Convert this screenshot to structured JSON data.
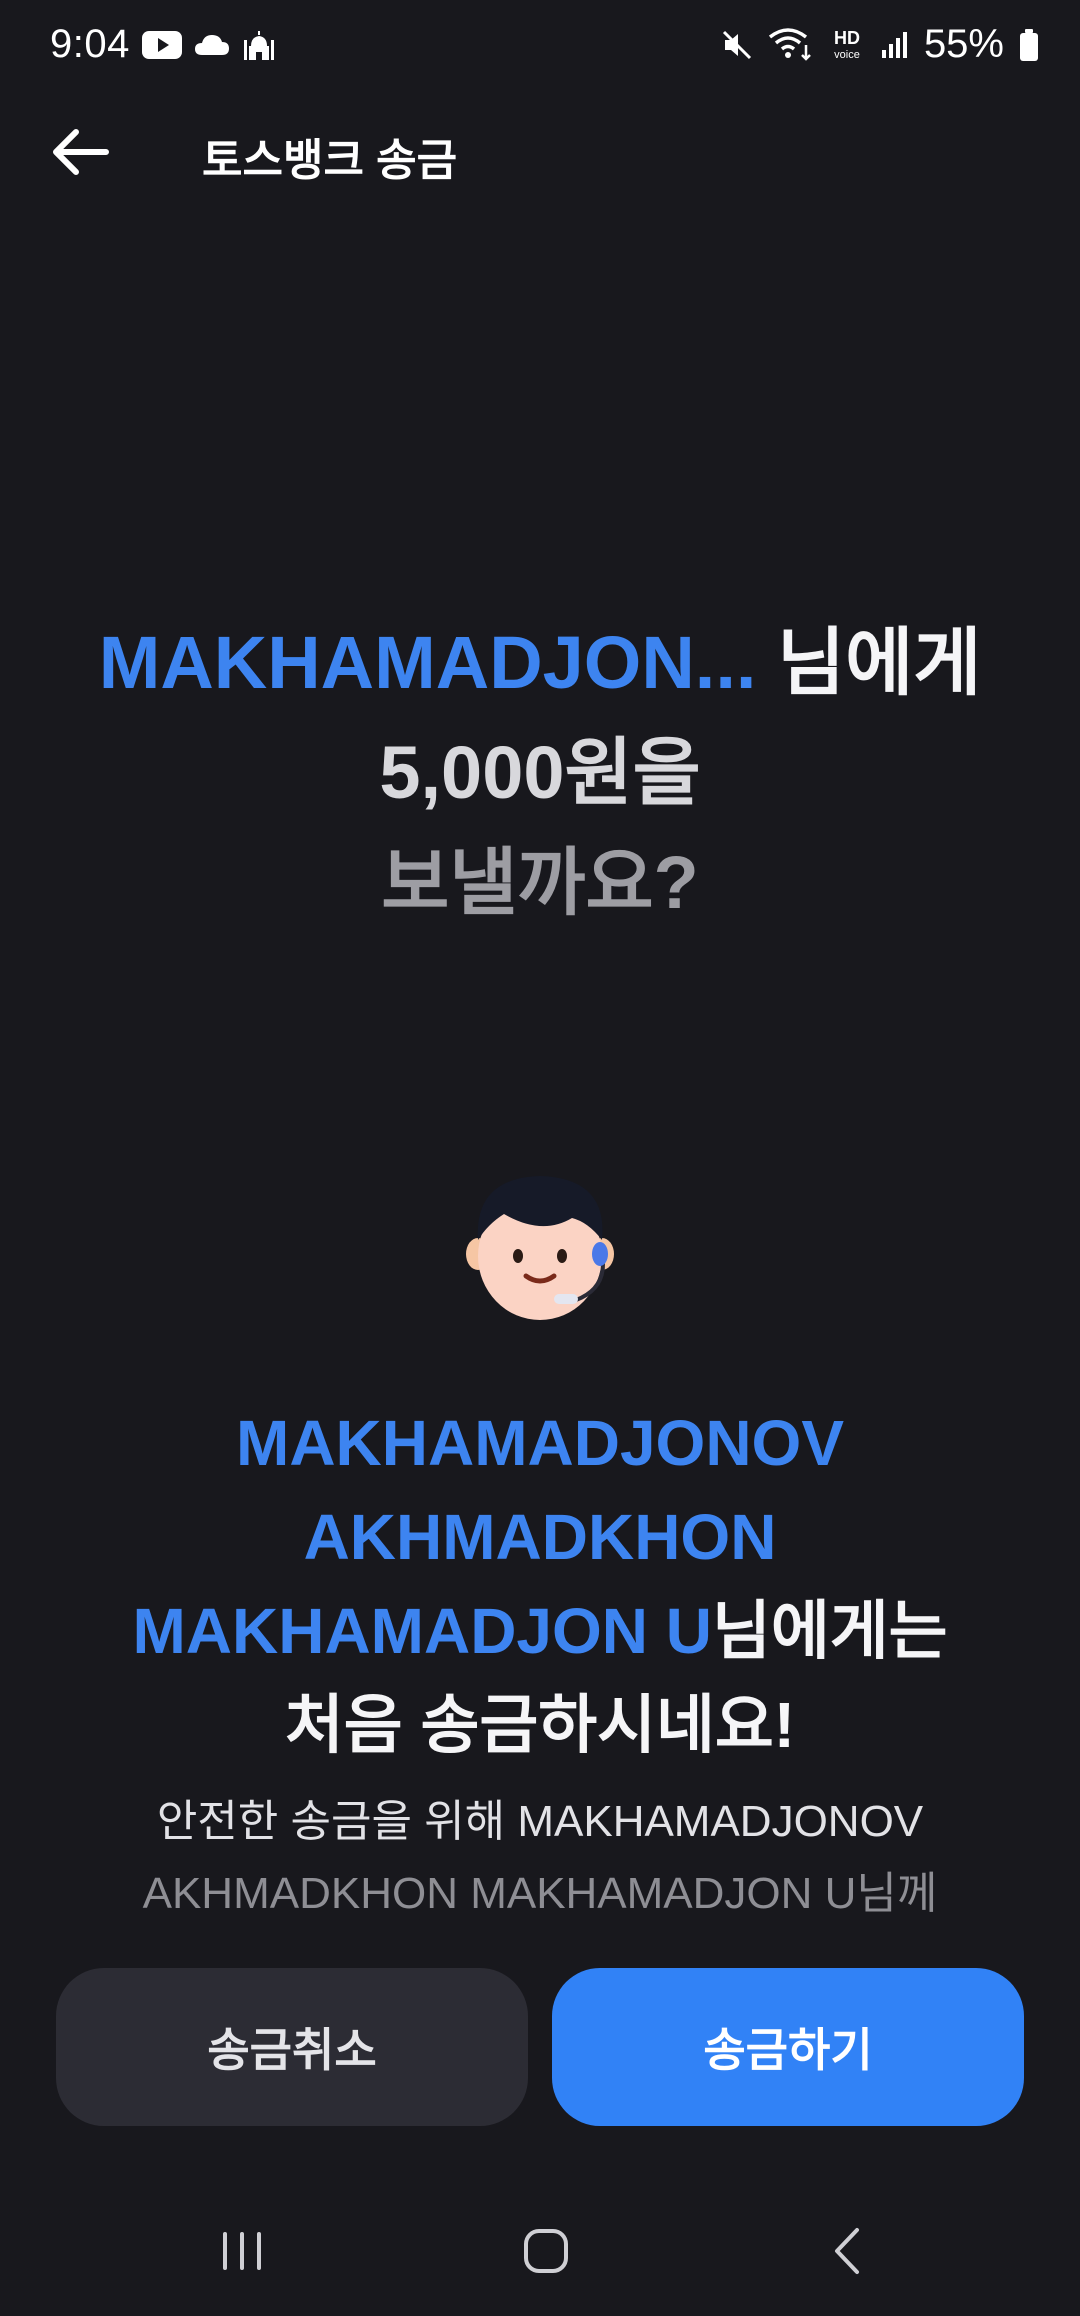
{
  "status_bar": {
    "time": "9:04",
    "battery": "55%",
    "hd_label": "HD",
    "voice_label": "voice",
    "left_icons": [
      "youtube-icon",
      "cloud-icon",
      "mosque-icon"
    ],
    "right_icons": [
      "mute-icon",
      "wifi-icon",
      "hd-voice-icon",
      "signal-icon",
      "battery-icon"
    ]
  },
  "header": {
    "title": "토스뱅크 송금"
  },
  "headline": {
    "recipient_short": "MAKHAMADJON...",
    "recipient_suffix": " 님에게",
    "amount": "5,000원을",
    "question": "보낼까요?"
  },
  "notice": {
    "line1": "MAKHAMADJONOV",
    "line2": "AKHMADKHON",
    "line3_name": "MAKHAMADJON U",
    "line3_suffix": "님에게는",
    "line4": "처음 송금하시네요!",
    "desc_line1": "안전한 송금을 위해 MAKHAMADJONOV",
    "desc_line2": "AKHMADKHON MAKHAMADJON U님께"
  },
  "buttons": {
    "cancel": "송금취소",
    "send": "송금하기"
  },
  "colors": {
    "background": "#18181d",
    "accent_blue": "#3182f6",
    "name_blue": "#3d84f0",
    "button_dark": "#2c2c34"
  },
  "nav_bar": {
    "icons": [
      "recent-apps-icon",
      "home-icon",
      "back-nav-icon"
    ]
  }
}
